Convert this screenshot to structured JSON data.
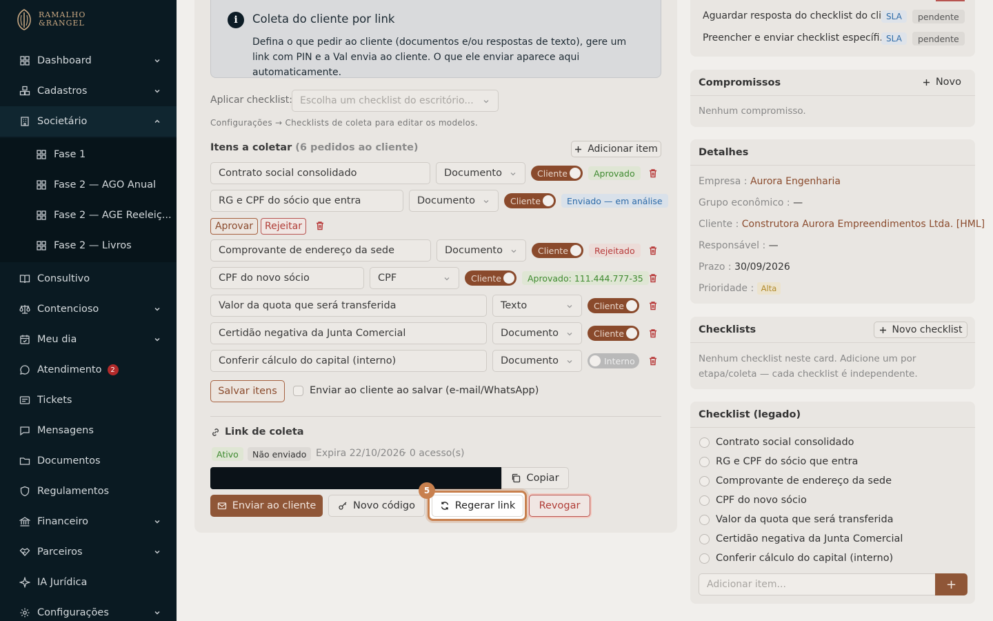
{
  "sidebar": {
    "logo_line1": "RAMALHO",
    "logo_line2": "&RANGEL",
    "items": [
      {
        "label": "Dashboard",
        "icon": "grid-icon",
        "chevron": "down"
      },
      {
        "label": "Cadastros",
        "icon": "boxes-icon",
        "chevron": "down"
      },
      {
        "label": "Societário",
        "icon": "building-icon",
        "chevron": "up"
      },
      {
        "label": "Consultivo",
        "icon": "book-icon"
      },
      {
        "label": "Contencioso",
        "icon": "scale-icon",
        "chevron": "down"
      },
      {
        "label": "Meu dia",
        "icon": "calendar-icon",
        "chevron": "down"
      },
      {
        "label": "Atendimento",
        "icon": "chat-icon",
        "badge": "2"
      },
      {
        "label": "Tickets",
        "icon": "ticket-icon"
      },
      {
        "label": "Mensagens",
        "icon": "message-icon"
      },
      {
        "label": "Documentos",
        "icon": "folder-icon"
      },
      {
        "label": "Regulamentos",
        "icon": "shield-icon"
      },
      {
        "label": "Financeiro",
        "icon": "bank-icon",
        "chevron": "down"
      },
      {
        "label": "Parceiros",
        "icon": "handshake-icon",
        "chevron": "down"
      },
      {
        "label": "IA Jurídica",
        "icon": "sparkle-icon"
      },
      {
        "label": "Configurações",
        "icon": "gear-icon",
        "chevron": "down"
      }
    ],
    "subitems": [
      {
        "label": "Fase 1"
      },
      {
        "label": "Fase 2 — AGO Anual"
      },
      {
        "label": "Fase 2 — AGE Reeleiç..."
      },
      {
        "label": "Fase 2 — Livros"
      }
    ]
  },
  "info": {
    "title": "Coleta do cliente por link",
    "text": "Defina o que pedir ao cliente (documentos e/ou respostas de texto), gere um link com PIN e a Val envia ao cliente. O que ele enviar aparece aqui automaticamente."
  },
  "checklist_apply": {
    "label": "Aplicar checklist:",
    "placeholder": "Escolha um checklist do escritório...",
    "note": "Configurações → Checklists de coleta para editar os modelos."
  },
  "items_section": {
    "title": "Itens a coletar",
    "count": "(6 pedidos ao cliente)",
    "add_label": "Adicionar item"
  },
  "items": [
    {
      "name": "Contrato social consolidado",
      "type": "Documento",
      "toggle": "Cliente",
      "status": "Aprovado"
    },
    {
      "name": "RG e CPF do sócio que entra",
      "type": "Documento",
      "toggle": "Cliente",
      "status": "Enviado — em análise"
    },
    {
      "name": "Comprovante de endereço da sede",
      "type": "Documento",
      "toggle": "Cliente",
      "status": "Rejeitado"
    },
    {
      "name": "CPF do novo sócio",
      "type": "CPF",
      "toggle": "Cliente",
      "status": "Aprovado: 111.444.777-35"
    },
    {
      "name": "Valor da quota que será transferida",
      "type": "Texto",
      "toggle": "Cliente"
    },
    {
      "name": "Certidão negativa da Junta Comercial",
      "type": "Documento",
      "toggle": "Cliente"
    },
    {
      "name": "Conferir cálculo do capital (interno)",
      "type": "Documento",
      "toggle": "Interno"
    }
  ],
  "review": {
    "approve": "Aprovar",
    "reject": "Rejeitar"
  },
  "save": {
    "label": "Salvar itens",
    "send_label": "Enviar ao cliente ao salvar (e-mail/WhatsApp)"
  },
  "link": {
    "title": "Link de coleta",
    "tag_active": "Ativo",
    "tag_sent": "Não enviado",
    "expires": "Expira 22/10/2026",
    "access": "· 0 acesso(s)",
    "copy": "Copiar",
    "send": "Enviar ao cliente",
    "new_code": "Novo código",
    "regen": "Regerar link",
    "revoke": "Revogar",
    "step": "5"
  },
  "right": {
    "tasks": [
      {
        "text": "Aguardar resposta do checklist do cli...",
        "sla": "SLA",
        "status": "pendente"
      },
      {
        "text": "Preencher e enviar checklist específi...",
        "sla": "SLA",
        "status": "pendente"
      }
    ],
    "compromissos": {
      "title": "Compromissos",
      "new": "Novo",
      "empty": "Nenhum compromisso."
    },
    "detalhes": {
      "title": "Detalhes",
      "empresa_lbl": "Empresa :",
      "empresa": "Aurora Engenharia",
      "grupo_lbl": "Grupo econômico :",
      "grupo": "—",
      "cliente_lbl": "Cliente :",
      "cliente": "Construtora Aurora Empreendimentos Ltda. [HML]",
      "resp_lbl": "Responsável :",
      "resp": "—",
      "prazo_lbl": "Prazo :",
      "prazo": "30/09/2026",
      "prio_lbl": "Prioridade :",
      "prio": "Alta"
    },
    "checklists": {
      "title": "Checklists",
      "new": "Novo checklist",
      "empty": "Nenhum checklist neste card. Adicione um por etapa/coleta — cada checklist é independente."
    },
    "legacy": {
      "title": "Checklist (legado)",
      "items": [
        "Contrato social consolidado",
        "RG e CPF do sócio que entra",
        "Comprovante de endereço da sede",
        "CPF do novo sócio",
        "Valor da quota que será transferida",
        "Certidão negativa da Junta Comercial",
        "Conferir cálculo do capital (interno)"
      ],
      "placeholder": "Adicionar item...",
      "add": "+"
    }
  },
  "colors": {
    "sidebar": "#0a1a22",
    "accent": "#8f5637",
    "highlight": "#c8804e"
  }
}
